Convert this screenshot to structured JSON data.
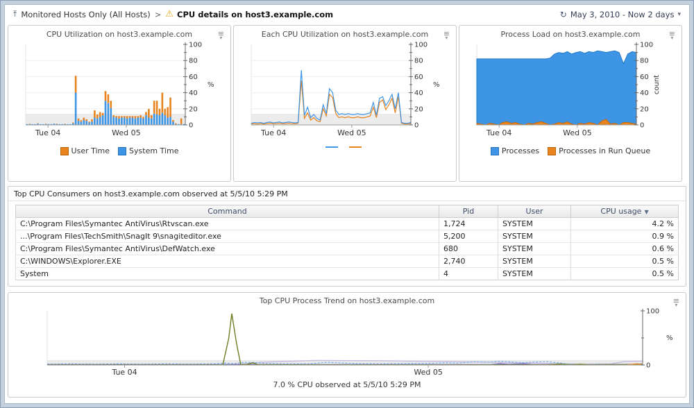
{
  "icons": {
    "up": "⤒",
    "warning": "⚠",
    "clock": "↻",
    "chevron_down": "▾",
    "menu": "≡",
    "menu_arrow": "▾",
    "sort_desc": "▼"
  },
  "breadcrumb": {
    "parent": "Monitored Hosts Only (All Hosts)",
    "separator": ">",
    "current": "CPU details on host3.example.com"
  },
  "timerange": {
    "label": "May 3, 2010 - Now 2 days"
  },
  "colors": {
    "blue": "#3e95e6",
    "orange": "#e8831d",
    "blue_border": "#2a72b8",
    "orange_border": "#b86410",
    "olive": "#6d7c21",
    "purple": "#5a4fa0",
    "lavender": "#c9bce3",
    "dashed_blue": "#6aaee8"
  },
  "chart_data": [
    {
      "type": "stacked_bar",
      "title": "CPU Utilization on host3.example.com",
      "ylabel": "%",
      "ylim": [
        0,
        100
      ],
      "ytick_label_step": 20,
      "ytick_minor_step": 10,
      "band": 13,
      "xticks": [
        {
          "pos": 0.14,
          "label": "Tue 04"
        },
        {
          "pos": 0.63,
          "label": "Wed 05"
        }
      ],
      "legend": [
        {
          "label": "User Time",
          "color": "#e8831d",
          "border": "#b86410",
          "shape": "square"
        },
        {
          "label": "System Time",
          "color": "#3e95e6",
          "border": "#2a72b8",
          "shape": "square"
        }
      ],
      "series": [
        {
          "name": "System Time",
          "color": "#3e95e6",
          "values": [
            1,
            1,
            1,
            1,
            1.5,
            1,
            1,
            1,
            1,
            1,
            1.5,
            1,
            1,
            1,
            1,
            1,
            1,
            2,
            40,
            5,
            4,
            6,
            5,
            3,
            4,
            9,
            8,
            10,
            12,
            30,
            27,
            21,
            10,
            9,
            8,
            9,
            9,
            8,
            9,
            9,
            8,
            9,
            9,
            8,
            12,
            9,
            8,
            14,
            13,
            12,
            15,
            12,
            9,
            10,
            4,
            1,
            1,
            1,
            1
          ]
        },
        {
          "name": "User Time",
          "color": "#e8831d",
          "values": [
            0,
            0.5,
            0,
            0,
            0.5,
            0,
            0,
            0.5,
            0,
            0,
            0,
            0.5,
            0,
            0,
            0.5,
            0,
            0,
            1,
            21,
            3,
            2,
            3,
            2,
            1,
            3,
            9,
            5,
            6,
            3,
            12,
            11,
            9,
            2,
            2,
            3,
            2,
            2,
            3,
            2,
            2,
            3,
            2,
            3,
            2,
            4,
            11,
            4,
            16,
            17,
            8,
            25,
            8,
            13,
            24,
            2,
            1,
            0,
            7,
            0
          ]
        }
      ]
    },
    {
      "type": "line",
      "title": "Each CPU Utilization on host3.example.com",
      "ylabel": "%",
      "ylim": [
        0,
        100
      ],
      "ytick_label_step": 20,
      "ytick_minor_step": 10,
      "band": 13,
      "xticks": [
        {
          "pos": 0.14,
          "label": "Tue 04"
        },
        {
          "pos": 0.63,
          "label": "Wed 05"
        }
      ],
      "legend": [
        {
          "label": "",
          "color": "#3e95e6",
          "shape": "line"
        },
        {
          "label": "",
          "color": "#e8831d",
          "shape": "line"
        }
      ],
      "series": [
        {
          "name": "cpu-orange",
          "color": "#e8831d",
          "width": 1.2,
          "values": [
            1,
            1.5,
            1,
            1.5,
            1,
            1.5,
            2,
            1.5,
            1.5,
            2,
            1.5,
            1.5,
            2,
            1.5,
            1.5,
            2,
            55,
            8,
            15,
            6,
            9,
            5,
            4,
            20,
            11,
            38,
            34,
            14,
            9,
            10,
            9,
            10,
            9,
            9,
            10,
            9,
            9,
            10,
            11,
            22,
            9,
            28,
            31,
            19,
            25,
            33,
            15,
            35,
            2,
            1,
            1,
            2
          ]
        },
        {
          "name": "cpu-blue",
          "color": "#3e95e6",
          "width": 1.2,
          "values": [
            2,
            3,
            2.5,
            3,
            2,
            3,
            3.5,
            2.5,
            3,
            3.5,
            2.5,
            3,
            3.5,
            3,
            2.5,
            3,
            68,
            12,
            22,
            9,
            13,
            8,
            6,
            25,
            14,
            45,
            40,
            18,
            13,
            14,
            13,
            14,
            13,
            13,
            14,
            13,
            13,
            14,
            15,
            28,
            12,
            33,
            35,
            24,
            30,
            38,
            20,
            40,
            3,
            2,
            2,
            3
          ]
        }
      ]
    },
    {
      "type": "area",
      "title": "Process Load on host3.example.com",
      "ylabel": "count",
      "ylabel_rotated": true,
      "ylim": [
        0,
        100
      ],
      "ytick_label_step": 20,
      "ytick_minor_step": 10,
      "xticks": [
        {
          "pos": 0.14,
          "label": "Tue 04"
        },
        {
          "pos": 0.63,
          "label": "Wed 05"
        }
      ],
      "legend": [
        {
          "label": "Processes",
          "color": "#3e95e6",
          "border": "#2a72b8",
          "shape": "square"
        },
        {
          "label": "Processes in Run Queue",
          "color": "#e8831d",
          "border": "#b86410",
          "shape": "square"
        }
      ],
      "series": [
        {
          "name": "Processes",
          "color": "#3e95e6",
          "stroke": "#1e78c8",
          "values": [
            82,
            82,
            82,
            82,
            82,
            82,
            82,
            82,
            82,
            82,
            82,
            82,
            82,
            82,
            82,
            82,
            82,
            83,
            88,
            90,
            89,
            91,
            88,
            90,
            91,
            89,
            91,
            90,
            92,
            91,
            90,
            91,
            92,
            90,
            76,
            88,
            91,
            90
          ]
        },
        {
          "name": "Processes in Run Queue",
          "color": "#e8831d",
          "stroke": "#c06a10",
          "values": [
            2,
            1,
            0,
            2,
            1,
            0,
            3,
            4,
            2,
            3,
            1,
            0,
            2,
            1,
            3,
            4,
            2,
            0,
            1,
            3,
            2,
            4,
            1,
            0,
            2,
            1,
            3,
            2,
            0,
            5,
            7,
            1,
            2,
            0,
            3,
            3,
            2,
            1
          ]
        }
      ]
    },
    {
      "type": "line",
      "title": "Top CPU Process Trend on host3.example.com",
      "caption": "7.0 % CPU observed at 5/5/10 5:29 PM",
      "ylabel": "%",
      "ylim": [
        0,
        100
      ],
      "ytick_label_step": 100,
      "ytick_minor_step": 50,
      "band": 8,
      "xticks": [
        {
          "pos": 0.13,
          "label": "Tue 04"
        },
        {
          "pos": 0.64,
          "label": "Wed 05"
        }
      ],
      "series": [
        {
          "name": "series-lavender",
          "color": "#c9bce3",
          "width": 1.4,
          "points": [
            [
              0.31,
              0.5
            ],
            [
              0.36,
              5
            ],
            [
              0.45,
              8.5
            ],
            [
              0.55,
              8
            ],
            [
              0.65,
              6.5
            ],
            [
              0.75,
              5
            ],
            [
              0.82,
              3.5
            ],
            [
              0.87,
              2
            ],
            [
              0.91,
              1
            ],
            [
              0.945,
              1.5
            ],
            [
              0.97,
              6.5
            ],
            [
              1,
              7
            ]
          ]
        },
        {
          "name": "series-blue-dashed",
          "color": "#6aaee8",
          "width": 1.1,
          "dash": "3,2",
          "points": [
            [
              0,
              1.5
            ],
            [
              0.04,
              2
            ],
            [
              0.08,
              1.5
            ],
            [
              0.12,
              2
            ],
            [
              0.16,
              1.5
            ],
            [
              0.2,
              2
            ],
            [
              0.24,
              1.5
            ],
            [
              0.28,
              2
            ],
            [
              0.3,
              3.5
            ],
            [
              0.315,
              2.5
            ],
            [
              0.33,
              5
            ],
            [
              0.35,
              4.5
            ],
            [
              0.37,
              2.5
            ],
            [
              0.4,
              2
            ],
            [
              0.44,
              2
            ],
            [
              0.47,
              5
            ],
            [
              0.49,
              4
            ],
            [
              0.52,
              2.5
            ],
            [
              0.56,
              2
            ],
            [
              0.6,
              2.5
            ],
            [
              0.64,
              3
            ],
            [
              0.67,
              4
            ],
            [
              0.69,
              3.5
            ],
            [
              0.72,
              6
            ],
            [
              0.74,
              5
            ],
            [
              0.76,
              7
            ],
            [
              0.78,
              5.5
            ],
            [
              0.8,
              4.5
            ],
            [
              0.82,
              5.5
            ],
            [
              0.84,
              6
            ],
            [
              0.86,
              4
            ],
            [
              0.875,
              1.5
            ],
            [
              0.9,
              1
            ],
            [
              0.93,
              1.5
            ],
            [
              0.96,
              1
            ],
            [
              0.98,
              1.5
            ],
            [
              1,
              2.5
            ]
          ]
        },
        {
          "name": "series-purple",
          "color": "#5a4fa0",
          "width": 1.4,
          "points": [
            [
              0,
              0.8
            ],
            [
              0.1,
              0.8
            ],
            [
              0.2,
              0.8
            ],
            [
              0.3,
              0.8
            ],
            [
              0.4,
              0.8
            ],
            [
              0.5,
              0.8
            ],
            [
              0.6,
              0.8
            ],
            [
              0.7,
              0.8
            ],
            [
              0.745,
              0.8
            ],
            [
              0.76,
              2.2
            ],
            [
              0.775,
              1.2
            ],
            [
              0.8,
              2
            ],
            [
              0.815,
              0.8
            ],
            [
              0.9,
              0.8
            ],
            [
              1,
              1
            ]
          ]
        },
        {
          "name": "series-olive",
          "color": "#6d7c21",
          "width": 1.4,
          "points": [
            [
              0,
              0.3
            ],
            [
              0.295,
              0.3
            ],
            [
              0.305,
              50
            ],
            [
              0.31,
              95
            ],
            [
              0.318,
              40
            ],
            [
              0.325,
              0.5
            ],
            [
              0.335,
              1
            ],
            [
              0.345,
              4
            ],
            [
              0.355,
              0.5
            ],
            [
              0.5,
              0.3
            ],
            [
              0.7,
              0.3
            ],
            [
              0.84,
              0.4
            ],
            [
              0.86,
              1.8
            ],
            [
              0.88,
              0.4
            ],
            [
              0.895,
              1.5
            ],
            [
              0.91,
              0.4
            ],
            [
              0.95,
              0.6
            ],
            [
              1,
              0.6
            ]
          ]
        },
        {
          "name": "series-orange",
          "color": "#e8831d",
          "width": 1.4,
          "points": [
            [
              0.975,
              0.4
            ],
            [
              0.99,
              2.2
            ],
            [
              1,
              1.2
            ]
          ]
        }
      ]
    }
  ],
  "table": {
    "title": "Top CPU Consumers on host3.example.com observed at 5/5/10 5:29 PM",
    "columns": [
      "Command",
      "Pid",
      "User",
      "CPU usage"
    ],
    "sorted_column": "CPU usage",
    "sort_order": "desc",
    "rows": [
      {
        "command": "C:\\Program Files\\Symantec AntiVirus\\Rtvscan.exe",
        "pid": "1,724",
        "user": "SYSTEM",
        "cpu": "4.2 %"
      },
      {
        "command": "...\\Program Files\\TechSmith\\SnagIt 9\\snagiteditor.exe",
        "pid": "5,200",
        "user": "SYSTEM",
        "cpu": "0.9 %"
      },
      {
        "command": "C:\\Program Files\\Symantec AntiVirus\\DefWatch.exe",
        "pid": "680",
        "user": "SYSTEM",
        "cpu": "0.6 %"
      },
      {
        "command": "C:\\WINDOWS\\Explorer.EXE",
        "pid": "2,740",
        "user": "SYSTEM",
        "cpu": "0.5 %"
      },
      {
        "command": "System",
        "pid": "4",
        "user": "SYSTEM",
        "cpu": "0.5 %"
      }
    ]
  }
}
